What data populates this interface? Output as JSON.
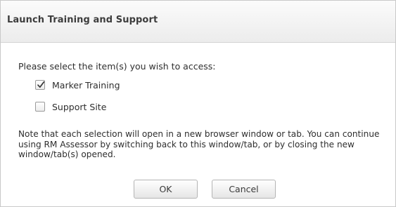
{
  "dialog": {
    "title": "Launch Training and Support",
    "prompt": "Please select the item(s) you wish to access:",
    "options": [
      {
        "label": "Marker Training",
        "checked": true
      },
      {
        "label": "Support Site",
        "checked": false
      }
    ],
    "note": "Note that each selection will open in a new browser window or tab. You can continue using RM Assessor by switching back to this window/tab, or by closing the new window/tab(s) opened.",
    "buttons": {
      "ok_label": "OK",
      "cancel_label": "Cancel"
    }
  },
  "icons": {
    "checked": "checkmark-icon"
  },
  "colors": {
    "titlebar_top": "#fbfbfb",
    "titlebar_bottom": "#ececec",
    "border": "#c9c9c9",
    "text": "#2e2e2e"
  }
}
